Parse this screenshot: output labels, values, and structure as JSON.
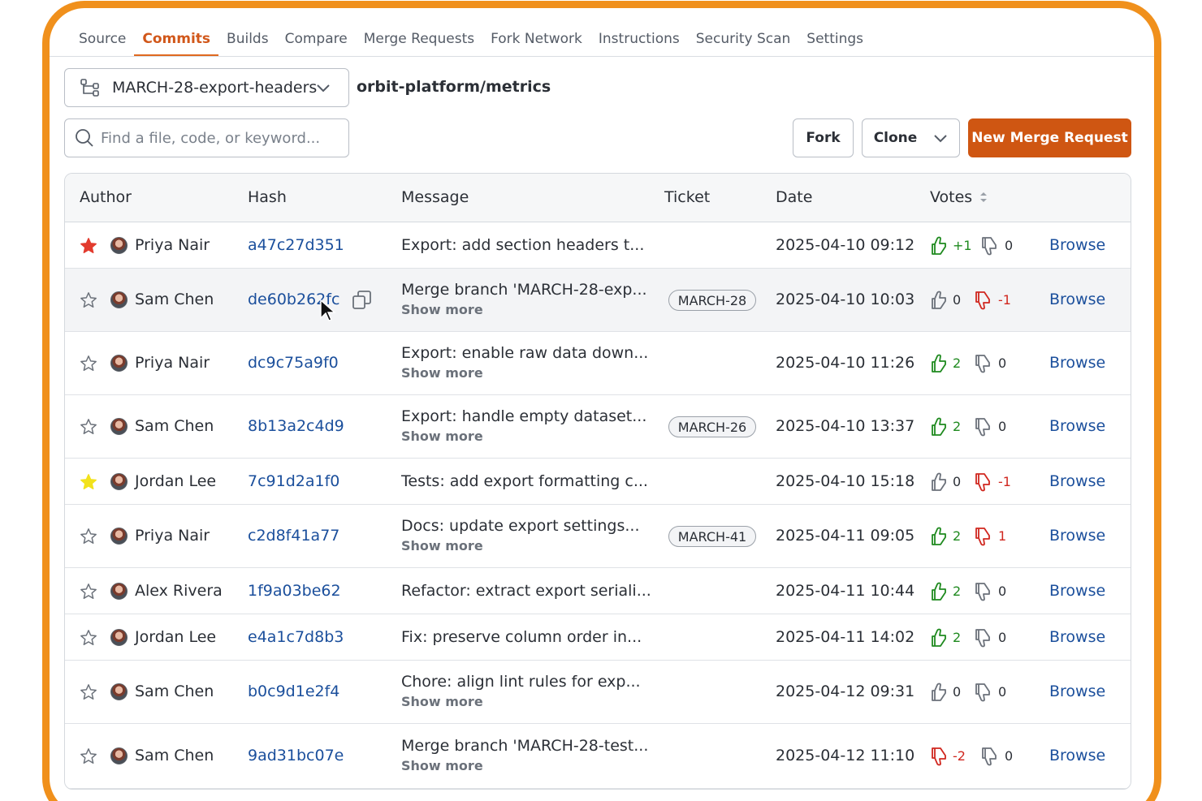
{
  "tabs": [
    {
      "label": "Source",
      "active": false
    },
    {
      "label": "Commits",
      "active": true
    },
    {
      "label": "Builds",
      "active": false
    },
    {
      "label": "Compare",
      "active": false
    },
    {
      "label": "Merge Requests",
      "active": false
    },
    {
      "label": "Fork Network",
      "active": false
    },
    {
      "label": "Instructions",
      "active": false
    },
    {
      "label": "Security Scan",
      "active": false
    },
    {
      "label": "Settings",
      "active": false
    }
  ],
  "branch": {
    "name": "MARCH-28-export-headers",
    "icon": "branch-icon"
  },
  "repo_path": "orbit-platform/metrics",
  "search": {
    "placeholder": "Find a file, code, or keyword...",
    "value": ""
  },
  "buttons": {
    "fork": "Fork",
    "clone": "Clone",
    "new_merge_request": "New Merge Request"
  },
  "table": {
    "columns": [
      "Author",
      "Hash",
      "Message",
      "Ticket",
      "Date",
      "Votes"
    ],
    "show_more_label": "Show more",
    "browse_label": "Browse",
    "rows": [
      {
        "starred": "red",
        "author": "Priya Nair",
        "hash": "a47c27d351",
        "message": "Export: add section headers t...",
        "show_more": false,
        "ticket": "",
        "date": "2025-04-10 09:12",
        "up": "+1",
        "up_active": true,
        "down": "0",
        "down_active": false
      },
      {
        "starred": "none",
        "author": "Sam Chen",
        "hash": "de60b262fc",
        "message": "Merge branch 'MARCH-28-exp...",
        "show_more": true,
        "ticket": "MARCH-28",
        "date": "2025-04-10 10:03",
        "up": "0",
        "up_active": false,
        "down": "-1",
        "down_active": true,
        "hover": true
      },
      {
        "starred": "none",
        "author": "Priya Nair",
        "hash": "dc9c75a9f0",
        "message": "Export: enable raw data down...",
        "show_more": true,
        "ticket": "",
        "date": "2025-04-10 11:26",
        "up": "2",
        "up_active": true,
        "down": "0",
        "down_active": false
      },
      {
        "starred": "none",
        "author": "Sam Chen",
        "hash": "8b13a2c4d9",
        "message": "Export: handle empty dataset...",
        "show_more": true,
        "ticket": "MARCH-26",
        "date": "2025-04-10 13:37",
        "up": "2",
        "up_active": true,
        "down": "0",
        "down_active": false
      },
      {
        "starred": "yellow",
        "author": "Jordan Lee",
        "hash": "7c91d2a1f0",
        "message": "Tests: add export formatting c...",
        "show_more": false,
        "ticket": "",
        "date": "2025-04-10 15:18",
        "up": "0",
        "up_active": false,
        "down": "-1",
        "down_active": true
      },
      {
        "starred": "none",
        "author": "Priya Nair",
        "hash": "c2d8f41a77",
        "message": "Docs: update export settings...",
        "show_more": true,
        "ticket": "MARCH-41",
        "date": "2025-04-11 09:05",
        "up": "2",
        "up_active": true,
        "down": "1",
        "down_active": true
      },
      {
        "starred": "none",
        "author": "Alex Rivera",
        "hash": "1f9a03be62",
        "message": "Refactor: extract export seriali...",
        "show_more": false,
        "ticket": "",
        "date": "2025-04-11 10:44",
        "up": "2",
        "up_active": true,
        "down": "0",
        "down_active": false
      },
      {
        "starred": "none",
        "author": "Jordan Lee",
        "hash": "e4a1c7d8b3",
        "message": "Fix: preserve column order in...",
        "show_more": false,
        "ticket": "",
        "date": "2025-04-11 14:02",
        "up": "2",
        "up_active": true,
        "down": "0",
        "down_active": false
      },
      {
        "starred": "none",
        "author": "Sam Chen",
        "hash": "b0c9d1e2f4",
        "message": "Chore: align lint rules for exp...",
        "show_more": true,
        "ticket": "",
        "date": "2025-04-12 09:31",
        "up": "0",
        "up_active": false,
        "down": "0",
        "down_active": false
      },
      {
        "starred": "none",
        "author": "Sam Chen",
        "hash": "9ad31bc07e",
        "message": "Merge branch 'MARCH-28-test...",
        "show_more": true,
        "ticket": "",
        "date": "2025-04-12 11:10",
        "up": "-2",
        "up_active": true,
        "up_as_down": true,
        "down": "0",
        "down_active": false
      }
    ]
  },
  "colors": {
    "accent": "#e0691f",
    "primary_button": "#cf5612",
    "link": "#1b4f9c",
    "vote_up": "#1f8a1f",
    "vote_down": "#d0271f",
    "frame": "#f0901c"
  }
}
